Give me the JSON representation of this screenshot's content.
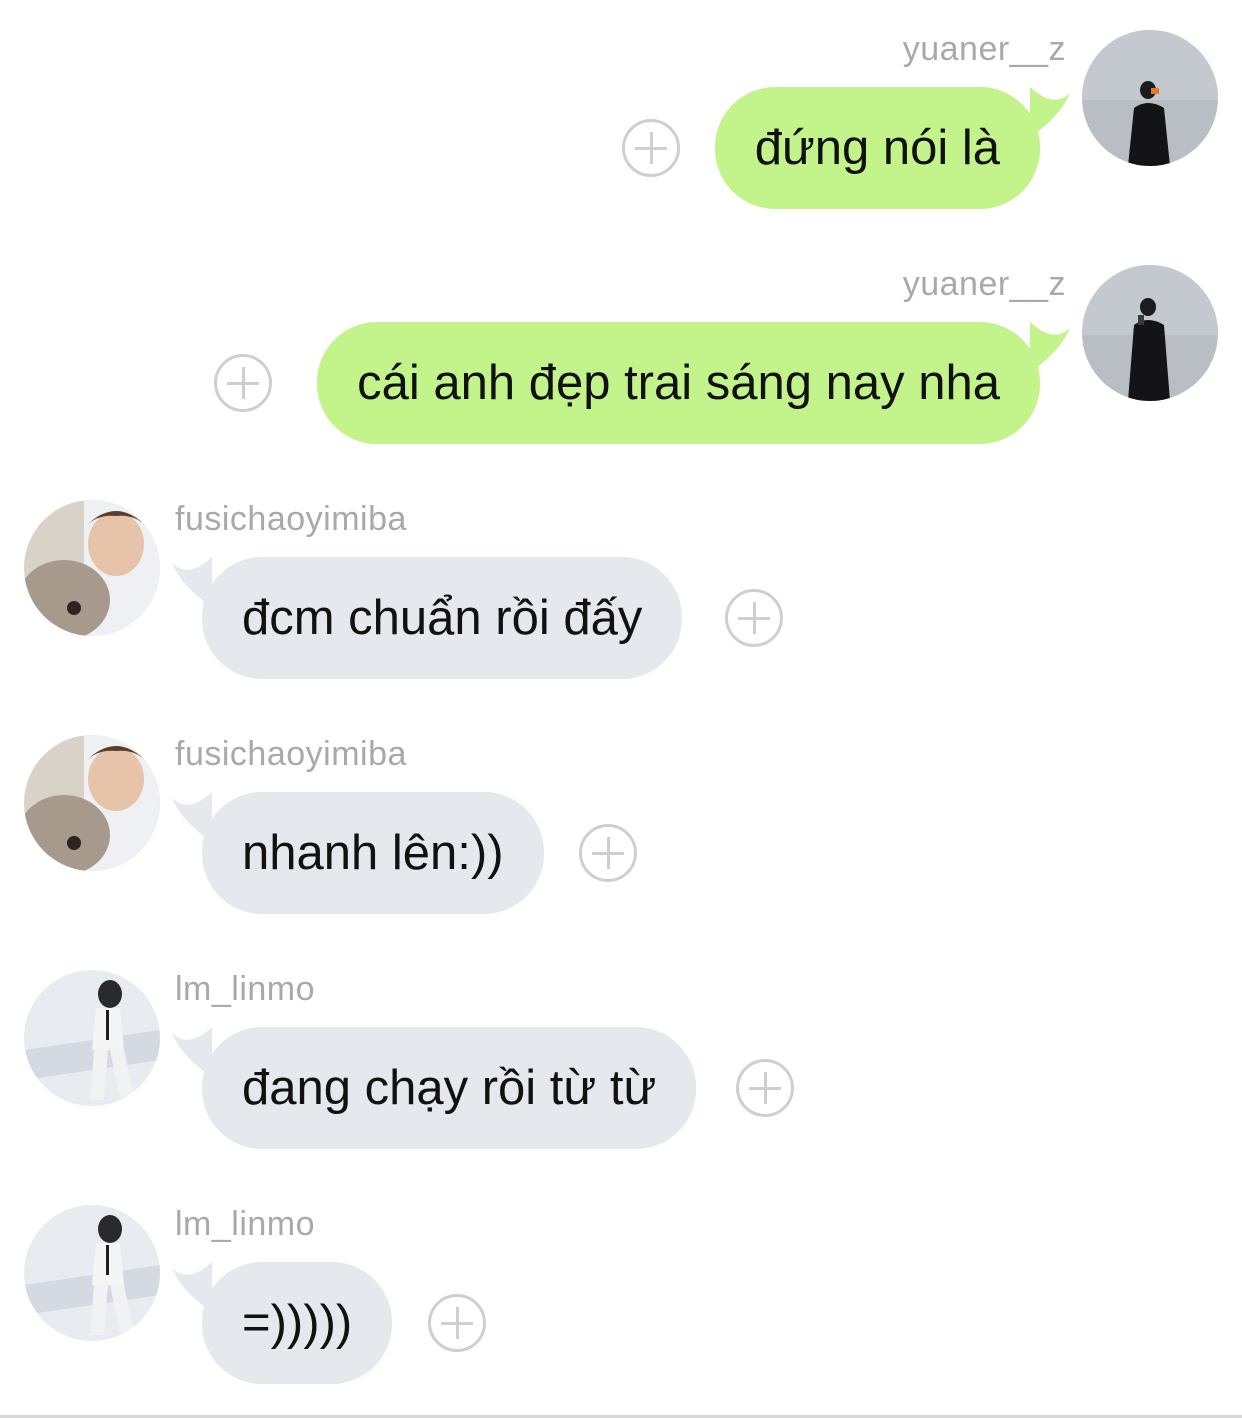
{
  "messages": [
    {
      "username": "yuaner__z",
      "text": "đứng nói là",
      "side": "right",
      "avatar": "avatar-yuaner"
    },
    {
      "username": "yuaner__z",
      "text": "cái anh đẹp trai sáng nay nha",
      "side": "right",
      "avatar": "avatar-yuaner"
    },
    {
      "username": "fusichaoyimiba",
      "text": "đcm chuẩn rồi đấy",
      "side": "left",
      "avatar": "avatar-fusichao"
    },
    {
      "username": "fusichaoyimiba",
      "text": "nhanh lên:))",
      "side": "left",
      "avatar": "avatar-fusichao"
    },
    {
      "username": "lm_linmo",
      "text": "đang chạy rồi từ từ",
      "side": "left",
      "avatar": "avatar-linmo"
    },
    {
      "username": "lm_linmo",
      "text": "=)))))",
      "side": "left",
      "avatar": "avatar-linmo"
    }
  ],
  "icons": {
    "add_reaction": "plus-circle-icon"
  },
  "colors": {
    "outgoing_bubble": "#c3f38b",
    "incoming_bubble": "#e5e8ec",
    "username_text": "#a9a9ad",
    "add_button": "#cfcfd2"
  }
}
